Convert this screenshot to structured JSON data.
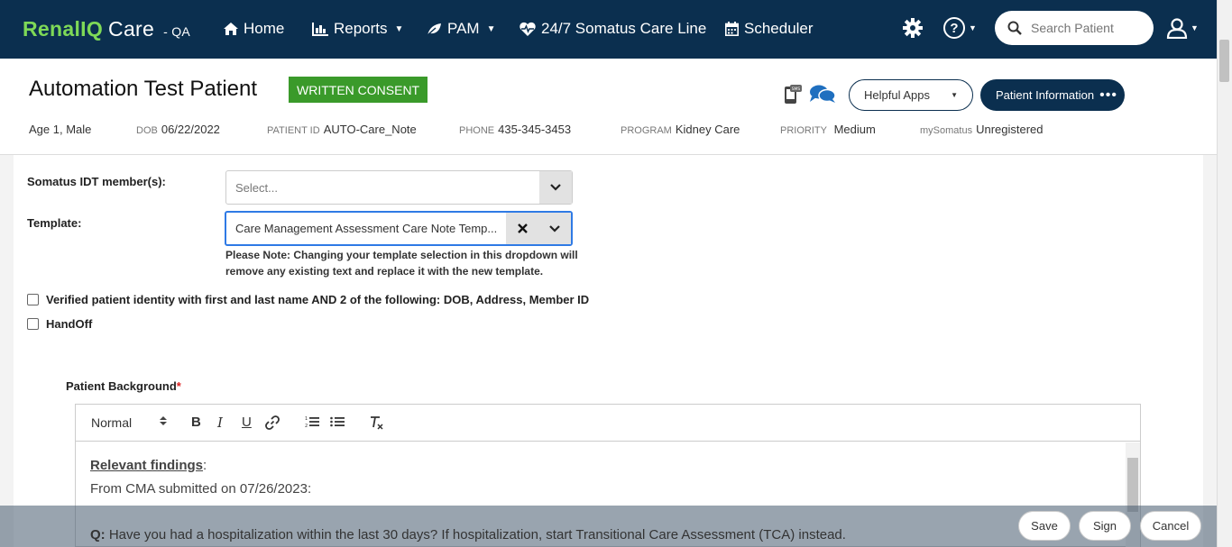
{
  "nav": {
    "logo_renal": "Renal",
    "logo_iq": "IQ",
    "logo_care": "Care",
    "env": "- QA",
    "home": "Home",
    "reports": "Reports",
    "pam": "PAM",
    "careline": "24/7 Somatus Care Line",
    "scheduler": "Scheduler",
    "search_placeholder": "Search Patient"
  },
  "patient": {
    "name": "Automation Test Patient",
    "consent": "WRITTEN CONSENT",
    "helpful_apps": "Helpful Apps",
    "patient_info": "Patient Information",
    "age_sex": "Age 1, Male",
    "dob_label": "DOB",
    "dob": "06/22/2022",
    "pid_label": "PATIENT ID",
    "pid": "AUTO-Care_Note",
    "phone_label": "PHONE",
    "phone": "435-345-3453",
    "program_label": "PROGRAM",
    "program": "Kidney Care",
    "priority_label": "PRIORITY",
    "priority": "Medium",
    "mysomatus_label": "mySomatus",
    "mysomatus": "Unregistered"
  },
  "form": {
    "idt_label": "Somatus IDT member(s):",
    "idt_placeholder": "Select...",
    "template_label": "Template:",
    "template_value": "Care Management Assessment Care Note Temp...",
    "template_note": "Please Note: Changing your template selection in this dropdown will remove any existing text and replace it with the new template.",
    "verified_label": "Verified patient identity with first and last name AND 2 of the following: DOB, Address, Member ID",
    "handoff_label": "HandOff",
    "pb_label": "Patient Background",
    "pb_required": "*"
  },
  "editor": {
    "style_select": "Normal",
    "relevant_findings": "Relevant findings",
    "colon": ":",
    "cma_line": "From CMA submitted on 07/26/2023:",
    "q_prefix": "Q:",
    "q_text": "Have you had a hospitalization within the last 30 days? If hospitalization, start Transitional Care Assessment (TCA) instead."
  },
  "footer": {
    "save": "Save",
    "sign": "Sign",
    "cancel": "Cancel"
  },
  "colors": {
    "nav_bg": "#0b2f4f",
    "brand_green": "#7ed957",
    "consent_green": "#3a9a2a",
    "focus_blue": "#2f7ae5"
  }
}
